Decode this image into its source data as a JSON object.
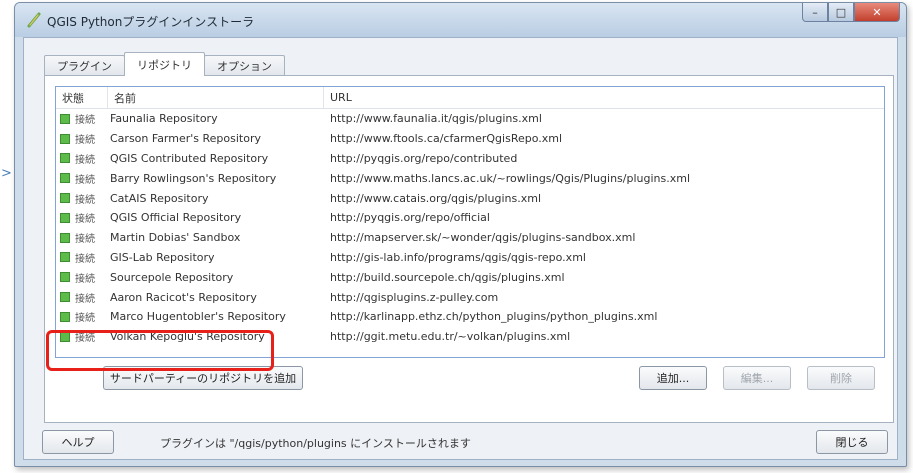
{
  "window": {
    "title": "QGIS Pythonプラグインインストーラ",
    "controls": {
      "minimize": "–",
      "maximize": "□",
      "close": "✕"
    }
  },
  "tabs": [
    {
      "label": "プラグイン"
    },
    {
      "label": "リポジトリ"
    },
    {
      "label": "オプション"
    }
  ],
  "repositories": {
    "columns": {
      "status": "状態",
      "name": "名前",
      "url": "URL"
    },
    "rows": [
      {
        "status": "接続",
        "name": "Faunalia Repository",
        "url": "http://www.faunalia.it/qgis/plugins.xml"
      },
      {
        "status": "接続",
        "name": "Carson Farmer's Repository",
        "url": "http://www.ftools.ca/cfarmerQgisRepo.xml"
      },
      {
        "status": "接続",
        "name": "QGIS Contributed Repository",
        "url": "http://pyqgis.org/repo/contributed"
      },
      {
        "status": "接続",
        "name": "Barry Rowlingson's Repository",
        "url": "http://www.maths.lancs.ac.uk/~rowlings/Qgis/Plugins/plugins.xml"
      },
      {
        "status": "接続",
        "name": "CatAIS Repository",
        "url": "http://www.catais.org/qgis/plugins.xml"
      },
      {
        "status": "接続",
        "name": "QGIS Official Repository",
        "url": "http://pyqgis.org/repo/official"
      },
      {
        "status": "接続",
        "name": "Martin Dobias' Sandbox",
        "url": "http://mapserver.sk/~wonder/qgis/plugins-sandbox.xml"
      },
      {
        "status": "接続",
        "name": "GIS-Lab Repository",
        "url": "http://gis-lab.info/programs/qgis/qgis-repo.xml"
      },
      {
        "status": "接続",
        "name": "Sourcepole Repository",
        "url": "http://build.sourcepole.ch/qgis/plugins.xml"
      },
      {
        "status": "接続",
        "name": "Aaron Racicot's Repository",
        "url": "http://qgisplugins.z-pulley.com"
      },
      {
        "status": "接続",
        "name": "Marco Hugentobler's Repository",
        "url": "http://karlinapp.ethz.ch/python_plugins/python_plugins.xml"
      },
      {
        "status": "接続",
        "name": "Volkan Kepoglu's Repository",
        "url": "http://ggit.metu.edu.tr/~volkan/plugins.xml"
      }
    ]
  },
  "buttons": {
    "add_third_party": "サードパーティーのリポジトリを追加",
    "add": "追加...",
    "edit": "編集...",
    "delete": "削除",
    "help": "ヘルプ",
    "close": "閉じる"
  },
  "footer": {
    "note": "プラグインは \"/qgis/python/plugins にインストールされます"
  },
  "colors": {
    "highlight": "#e8201a",
    "status_ok": "#5dbb4a",
    "titlebar": "#b9cde3"
  }
}
